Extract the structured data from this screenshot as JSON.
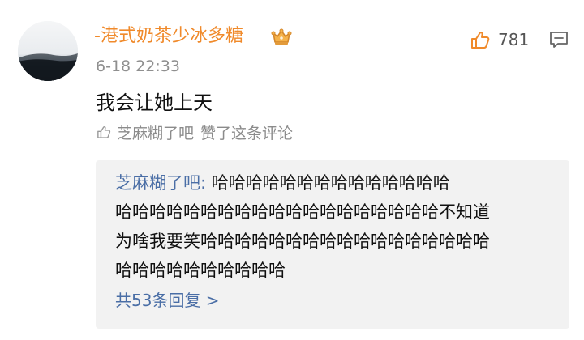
{
  "comment": {
    "username": "-港式奶茶少冰多糖",
    "timestamp": "6-18 22:33",
    "like_count": "781",
    "text": "我会让她上天",
    "liked_by": {
      "name": "芝麻糊了吧",
      "action": "赞了这条评论"
    }
  },
  "reply_preview": {
    "author": "芝麻糊了吧",
    "separator": ": ",
    "lines": [
      "哈哈哈哈哈哈哈哈哈哈哈哈哈哈",
      "哈哈哈哈哈哈哈哈哈哈哈哈哈哈哈哈哈哈哈不知道",
      "为啥我要笑哈哈哈哈哈哈哈哈哈哈哈哈哈哈哈哈哈",
      "哈哈哈哈哈哈哈哈哈哈"
    ],
    "more_label": "共53条回复 >"
  },
  "colors": {
    "username": "#f08a2b",
    "link": "#4a6ea6",
    "muted": "#8b8b8b",
    "reply_bg": "#f2f2f2"
  },
  "icons": {
    "crown": "crown-icon",
    "like": "thumbs-up-icon",
    "comment": "comment-icon",
    "liked_by": "small-thumbs-up-icon"
  }
}
